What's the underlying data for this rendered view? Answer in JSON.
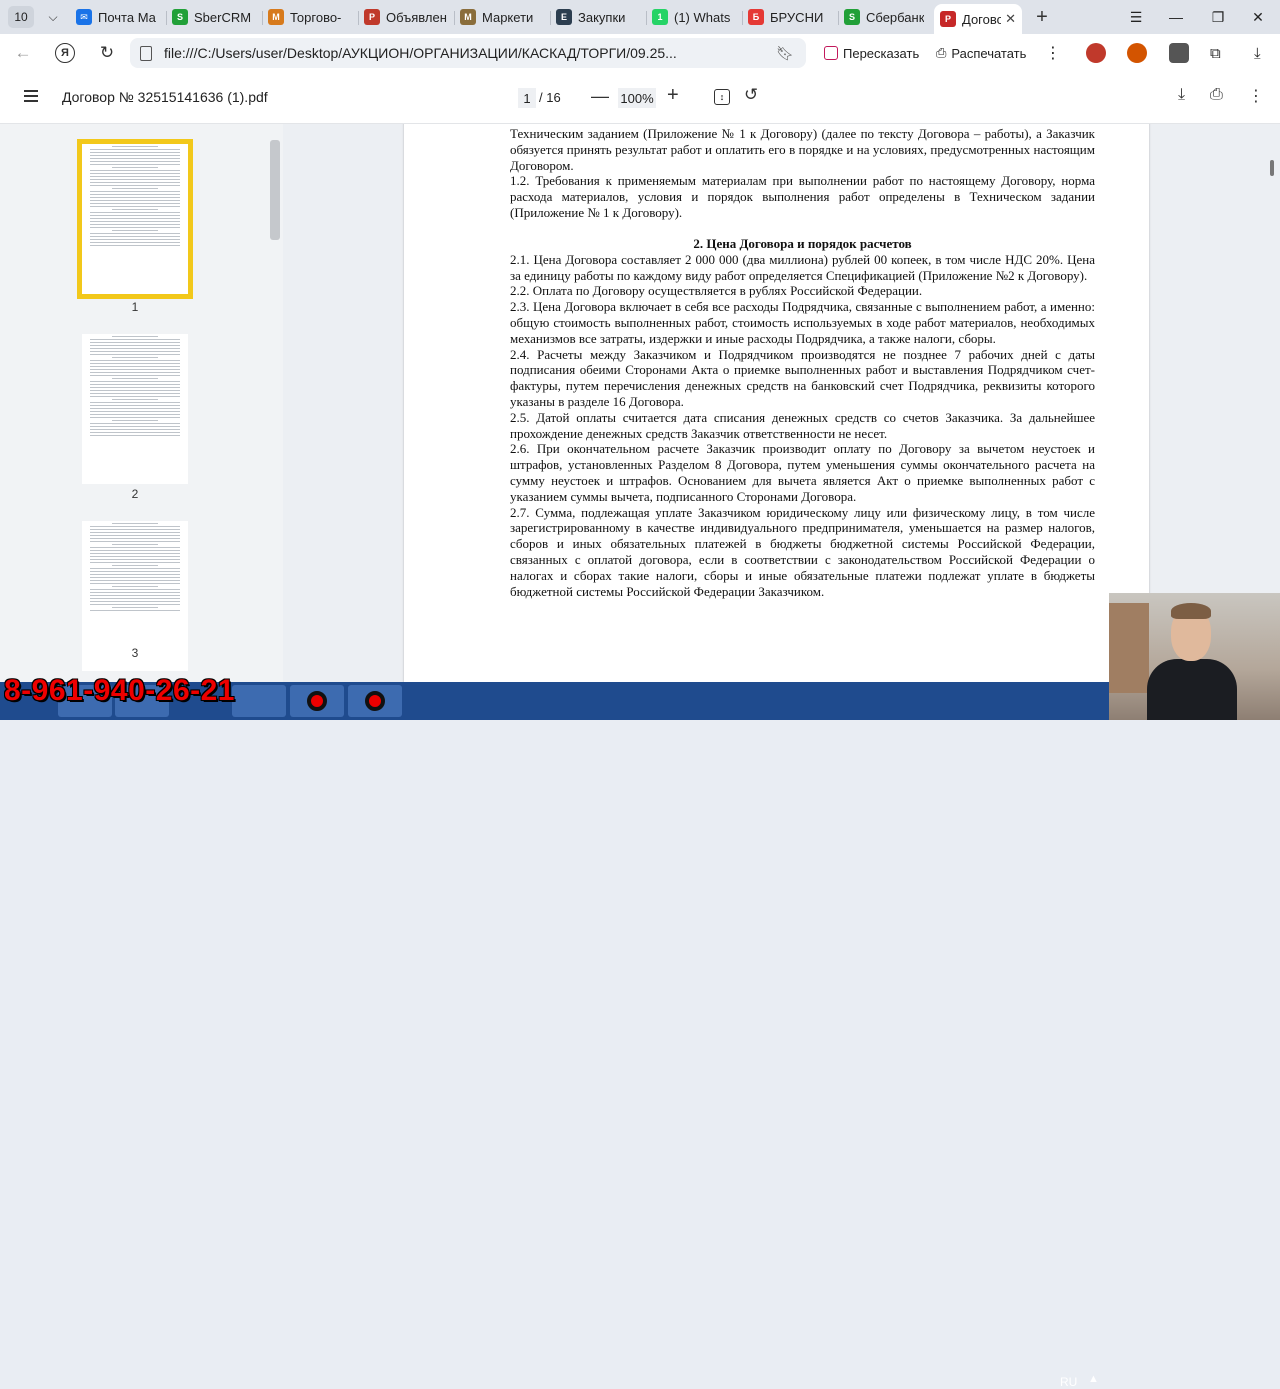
{
  "tabs": {
    "count": "10",
    "items": [
      {
        "label": "Почта Ма",
        "color": "#1a73e8",
        "glyph": "✉"
      },
      {
        "label": "SberCRM",
        "color": "#21a038",
        "glyph": "S"
      },
      {
        "label": "Торгово-",
        "color": "#d77a1c",
        "glyph": "M"
      },
      {
        "label": "Объявлен",
        "color": "#c0392b",
        "glyph": "P"
      },
      {
        "label": "Маркети",
        "color": "#8a6d3b",
        "glyph": "M"
      },
      {
        "label": "Закупки",
        "color": "#2c3e50",
        "glyph": "E"
      },
      {
        "label": "(1) Whats",
        "color": "#25d366",
        "glyph": "1"
      },
      {
        "label": "БРУСНИ",
        "color": "#e53935",
        "glyph": "Б"
      },
      {
        "label": "Сбербанк",
        "color": "#21a038",
        "glyph": "S"
      }
    ],
    "active": {
      "label": "Догово",
      "color": "#c62828",
      "glyph": "P"
    }
  },
  "address": {
    "url": "file:///C:/Users/user/Desktop/АУКЦИОН/ОРГАНИЗАЦИИ/КАСКАД/ТОРГИ/09.25...",
    "retell_label": "Пересказать",
    "print_label": "Распечатать"
  },
  "pdf": {
    "title": "Договор № 32515141636 (1).pdf",
    "page_current": "1",
    "page_total": "/ 16",
    "zoom": "100%"
  },
  "thumbnails": {
    "numbers": [
      "1",
      "2",
      "3"
    ],
    "selected_page": 1
  },
  "document": {
    "para_1_1_end": "Техническим заданием (Приложение № 1 к Договору) (далее по тексту Договора – работы), а Заказчик обязуется принять результат работ и оплатить его в порядке и на условиях, предусмотренных настоящим Договором.",
    "para_1_2": "1.2. Требования к применяемым материалам при выполнении работ по настоящему Договору, норма расхода материалов, условия и порядок выполнения работ определены в Техническом задании (Приложение № 1 к Договору).",
    "section_2_title": "2. Цена Договора и порядок расчетов",
    "para_2_1": "2.1. Цена Договора составляет 2 000 000 (два миллиона) рублей 00 копеек, в том числе НДС 20%. Цена за единицу работы по каждому виду работ определяется Спецификацией (Приложение №2 к Договору).",
    "para_2_2": "2.2. Оплата по Договору осуществляется в рублях Российской Федерации.",
    "para_2_3": "2.3. Цена Договора включает в себя все расходы Подрядчика, связанные с выполнением работ, а именно: общую стоимость выполненных работ, стоимость используемых в ходе работ материалов, необходимых механизмов все затраты, издержки и иные расходы Подрядчика, а также налоги, сборы.",
    "para_2_4": "2.4. Расчеты между Заказчиком и Подрядчиком производятся не позднее 7 рабочих дней с даты подписания обеими Сторонами Акта о приемке выполненных работ и выставления Подрядчиком счет-фактуры, путем перечисления денежных средств на банковский счет Подрядчика, реквизиты которого указаны в разделе 16 Договора.",
    "para_2_5": "2.5. Датой оплаты считается дата списания денежных средств со счетов Заказчика. За дальнейшее прохождение денежных средств Заказчик ответственности не несет.",
    "para_2_6": "2.6. При окончательном расчете Заказчик производит оплату по Договору за вычетом неустоек и штрафов, установленных Разделом 8 Договора, путем уменьшения суммы окончательного расчета на сумму неустоек и штрафов. Основанием для вычета является Акт о приемке выполненных работ с указанием суммы вычета, подписанного Сторонами Договора.",
    "para_2_7": "2.7. Сумма, подлежащая уплате Заказчиком юридическому лицу или физическому лицу, в том числе зарегистрированному в качестве индивидуального предпринимателя, уменьшается на размер налогов, сборов и иных обязательных платежей в бюджеты бюджетной системы Российской Федерации, связанных с оплатой договора, если в соответствии с законодательством Российской Федерации о налогах и сборах такие налоги, сборы и иные обязательные платежи подлежат уплате в бюджеты бюджетной системы Российской Федерации Заказчиком."
  },
  "overlay": {
    "phone": "8-961-940-26-21"
  },
  "taskbar": {
    "lang": "RU"
  }
}
